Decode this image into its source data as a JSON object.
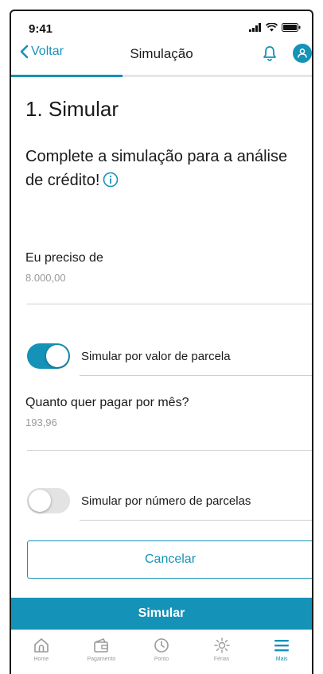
{
  "status_bar": {
    "time": "9:41"
  },
  "nav": {
    "back_label": "Voltar",
    "title": "Simulação",
    "progress": 0.37
  },
  "step": {
    "title": "1. Simular"
  },
  "intro": {
    "text": "Complete a simulação para a análise de crédito!"
  },
  "amount": {
    "label": "Eu preciso de",
    "value": "8.000,00"
  },
  "option_installment_value": {
    "label": "Simular por valor de parcela",
    "enabled": true
  },
  "monthly": {
    "label": "Quanto quer pagar por mês?",
    "value": "193,96"
  },
  "option_installment_count": {
    "label": "Simular por número de parcelas",
    "enabled": false
  },
  "buttons": {
    "cancel": "Cancelar",
    "simulate": "Simular"
  },
  "tabbar": {
    "items": [
      {
        "label": "Home",
        "icon": "home-icon",
        "active": false
      },
      {
        "label": "Pagamento",
        "icon": "wallet-icon",
        "active": false
      },
      {
        "label": "Ponto",
        "icon": "clock-icon",
        "active": false
      },
      {
        "label": "Férias",
        "icon": "sun-icon",
        "active": false
      },
      {
        "label": "Mais",
        "icon": "menu-icon",
        "active": true
      }
    ]
  },
  "colors": {
    "accent": "#1592b8",
    "muted_text": "#9a9a9a",
    "divider": "#cfcfcf",
    "toggle_off": "#e3e3e3"
  }
}
